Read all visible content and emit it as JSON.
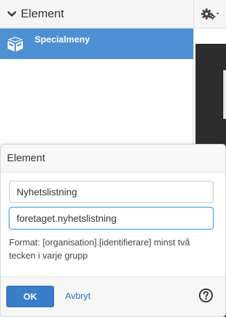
{
  "sidebar": {
    "header_title": "Element",
    "menu_item_label": "Specialmeny"
  },
  "dialog": {
    "title": "Element",
    "name_value": "Nyhetslistning",
    "identifier_value": "foretaget.nyhetslistning",
    "help_text": "Format: [organisation].[identifierare] minst två tecken i varje grupp",
    "ok_label": "OK",
    "cancel_label": "Avbryt"
  },
  "colors": {
    "accent": "#4d90d4",
    "primary_button": "#3a7dc9",
    "link": "#2f74c2"
  },
  "icons": [
    "chevron-down-icon",
    "gear-icon",
    "box-icon",
    "help-icon"
  ]
}
